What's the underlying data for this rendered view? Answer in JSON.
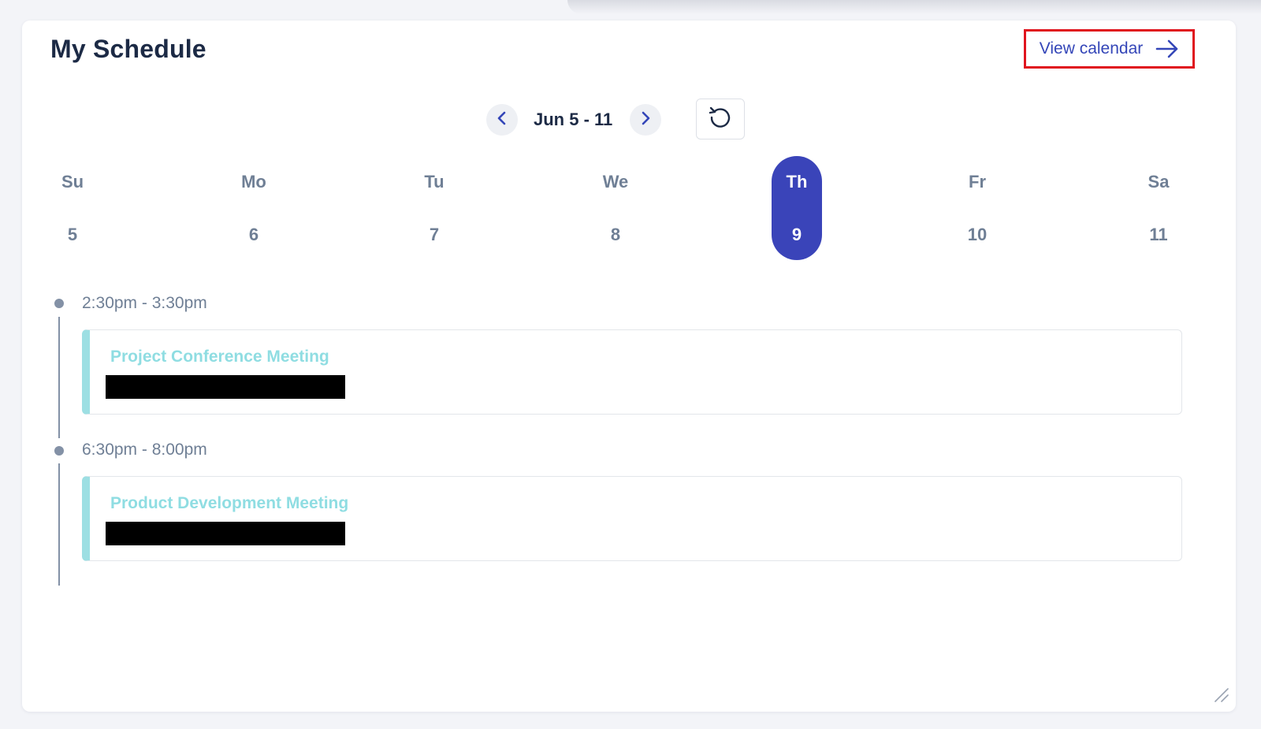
{
  "widget": {
    "title": "My Schedule",
    "view_calendar_label": "View calendar"
  },
  "week": {
    "range_label": "Jun 5 - 11",
    "prev_icon": "chevron-left-icon",
    "next_icon": "chevron-right-icon",
    "refresh_icon": "refresh-icon",
    "days": [
      {
        "name": "Su",
        "num": "5"
      },
      {
        "name": "Mo",
        "num": "6"
      },
      {
        "name": "Tu",
        "num": "7"
      },
      {
        "name": "We",
        "num": "8"
      },
      {
        "name": "Th",
        "num": "9",
        "selected": true
      },
      {
        "name": "Fr",
        "num": "10"
      },
      {
        "name": "Sa",
        "num": "11"
      }
    ]
  },
  "events": [
    {
      "time": "2:30pm - 3:30pm",
      "title": "Project Conference Meeting"
    },
    {
      "time": "6:30pm - 8:00pm",
      "title": "Product Development Meeting"
    }
  ],
  "colors": {
    "accent": "#3a44b9",
    "link": "#3446b8",
    "highlight_box": "#e0141e",
    "event_bar": "#9ddfe3",
    "event_title": "#8fdde2",
    "muted_text": "#6f7f95"
  }
}
